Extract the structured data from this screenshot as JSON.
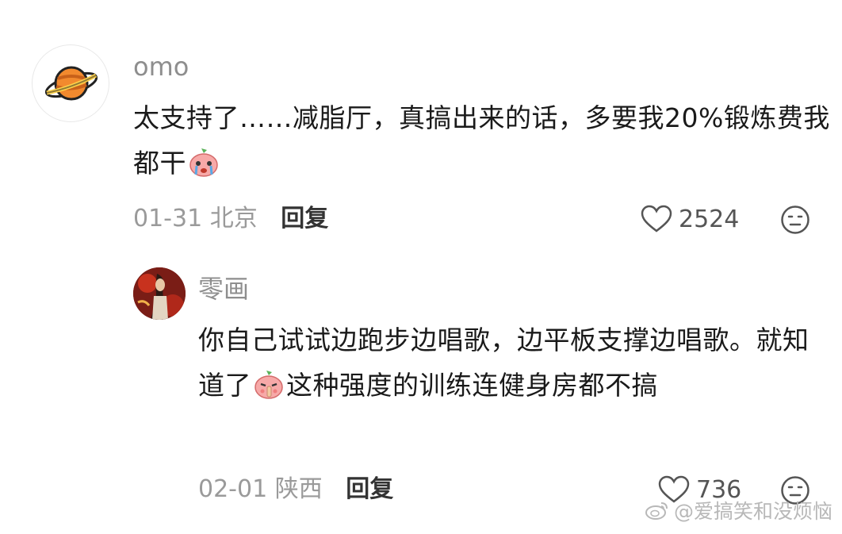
{
  "comment": {
    "username": "omo",
    "text_part1": "太支持了……减脂厅，真搞出来的话，多要我20%锻炼费我都干",
    "date": "01-31",
    "location": "北京",
    "reply_label": "回复",
    "likes": "2524",
    "avatar_icon": "planet-icon",
    "emoji_icon": "crying-peach-emoji"
  },
  "reply": {
    "username": "零画",
    "text_part1": "你自己试试边跑步边唱歌，边平板支撑边唱歌。就知道了",
    "text_part2": "这种强度的训练连健身房都不搞",
    "date": "02-01",
    "location": "陕西",
    "reply_label": "回复",
    "likes": "736",
    "emoji_icon": "shush-peach-emoji"
  },
  "watermark": {
    "text": "@爱搞笑和没烦恼"
  },
  "colors": {
    "meta_gray": "#9a9a9a",
    "text_dark": "#1a1a1a",
    "planet_orange": "#f28a2e",
    "peach_pink": "#f7a9a8"
  }
}
